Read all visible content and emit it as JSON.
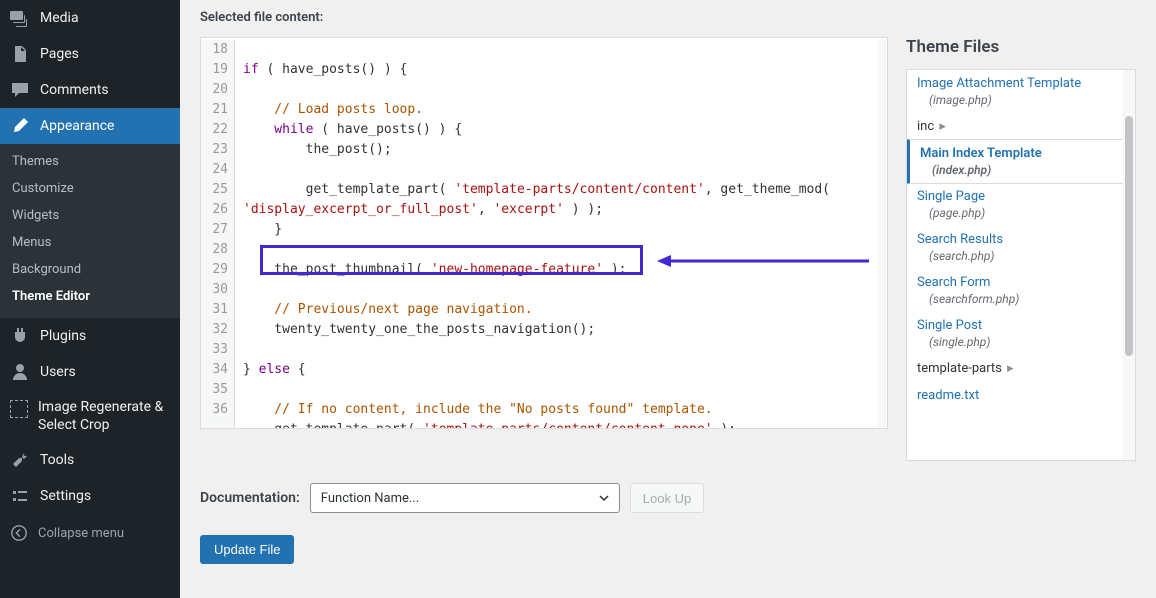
{
  "sidebar": {
    "items": [
      {
        "label": "Media"
      },
      {
        "label": "Pages"
      },
      {
        "label": "Comments"
      },
      {
        "label": "Appearance"
      },
      {
        "label": "Plugins"
      },
      {
        "label": "Users"
      },
      {
        "label": "Image Regenerate & Select Crop"
      },
      {
        "label": "Tools"
      },
      {
        "label": "Settings"
      }
    ],
    "submenu": [
      {
        "label": "Themes"
      },
      {
        "label": "Customize"
      },
      {
        "label": "Widgets"
      },
      {
        "label": "Menus"
      },
      {
        "label": "Background"
      },
      {
        "label": "Theme Editor"
      }
    ],
    "collapse": "Collapse menu"
  },
  "editor": {
    "selected_label": "Selected file content:",
    "line_start": 18,
    "line_end": 36,
    "code_lines": {
      "l18": "",
      "l19_kw": "if",
      "l19_after": " ( have_posts() ) {",
      "l20": "",
      "l21_c": "    // Load posts loop.",
      "l22_kw": "    while",
      "l22_after": " ( have_posts() ) {",
      "l23": "        the_post();",
      "l24": "",
      "l25_a": "        get_template_part( ",
      "l25_s1": "'template-parts/content/content'",
      "l25_b": ", get_theme_mod( ",
      "l25_s2": "'display_excerpt_or_full_post'",
      "l25_c2": ", ",
      "l25_s3": "'excerpt'",
      "l25_d": " ) );",
      "l26": "    }",
      "l27": "",
      "l28_a": "    the_post_thumbnail( ",
      "l28_s": "'new-homepage-feature'",
      "l28_b": " );",
      "l29": "",
      "l30_c": "    // Previous/next page navigation.",
      "l31": "    twenty_twenty_one_the_posts_navigation();",
      "l32": "",
      "l33_a": "} ",
      "l33_kw": "else",
      "l33_b": " {",
      "l34": "",
      "l35_c": "    // If no content, include the \"No posts found\" template.",
      "l36_a": "    get_template_part( ",
      "l36_s": "'template-parts/content/content-none'",
      "l36_b": " );"
    }
  },
  "files": {
    "title": "Theme Files",
    "items": [
      {
        "label": "Image Attachment Template",
        "file": "(image.php)",
        "type": "link"
      },
      {
        "label": "inc",
        "type": "dir"
      },
      {
        "label": "Main Index Template",
        "file": "(index.php)",
        "type": "current"
      },
      {
        "label": "Single Page",
        "file": "(page.php)",
        "type": "link"
      },
      {
        "label": "Search Results",
        "file": "(search.php)",
        "type": "link"
      },
      {
        "label": "Search Form",
        "file": "(searchform.php)",
        "type": "link"
      },
      {
        "label": "Single Post",
        "file": "(single.php)",
        "type": "link"
      },
      {
        "label": "template-parts",
        "type": "dir"
      },
      {
        "label": "readme.txt",
        "type": "plain"
      }
    ]
  },
  "controls": {
    "doc_label": "Documentation:",
    "doc_placeholder": "Function Name...",
    "lookup": "Look Up",
    "update": "Update File"
  }
}
